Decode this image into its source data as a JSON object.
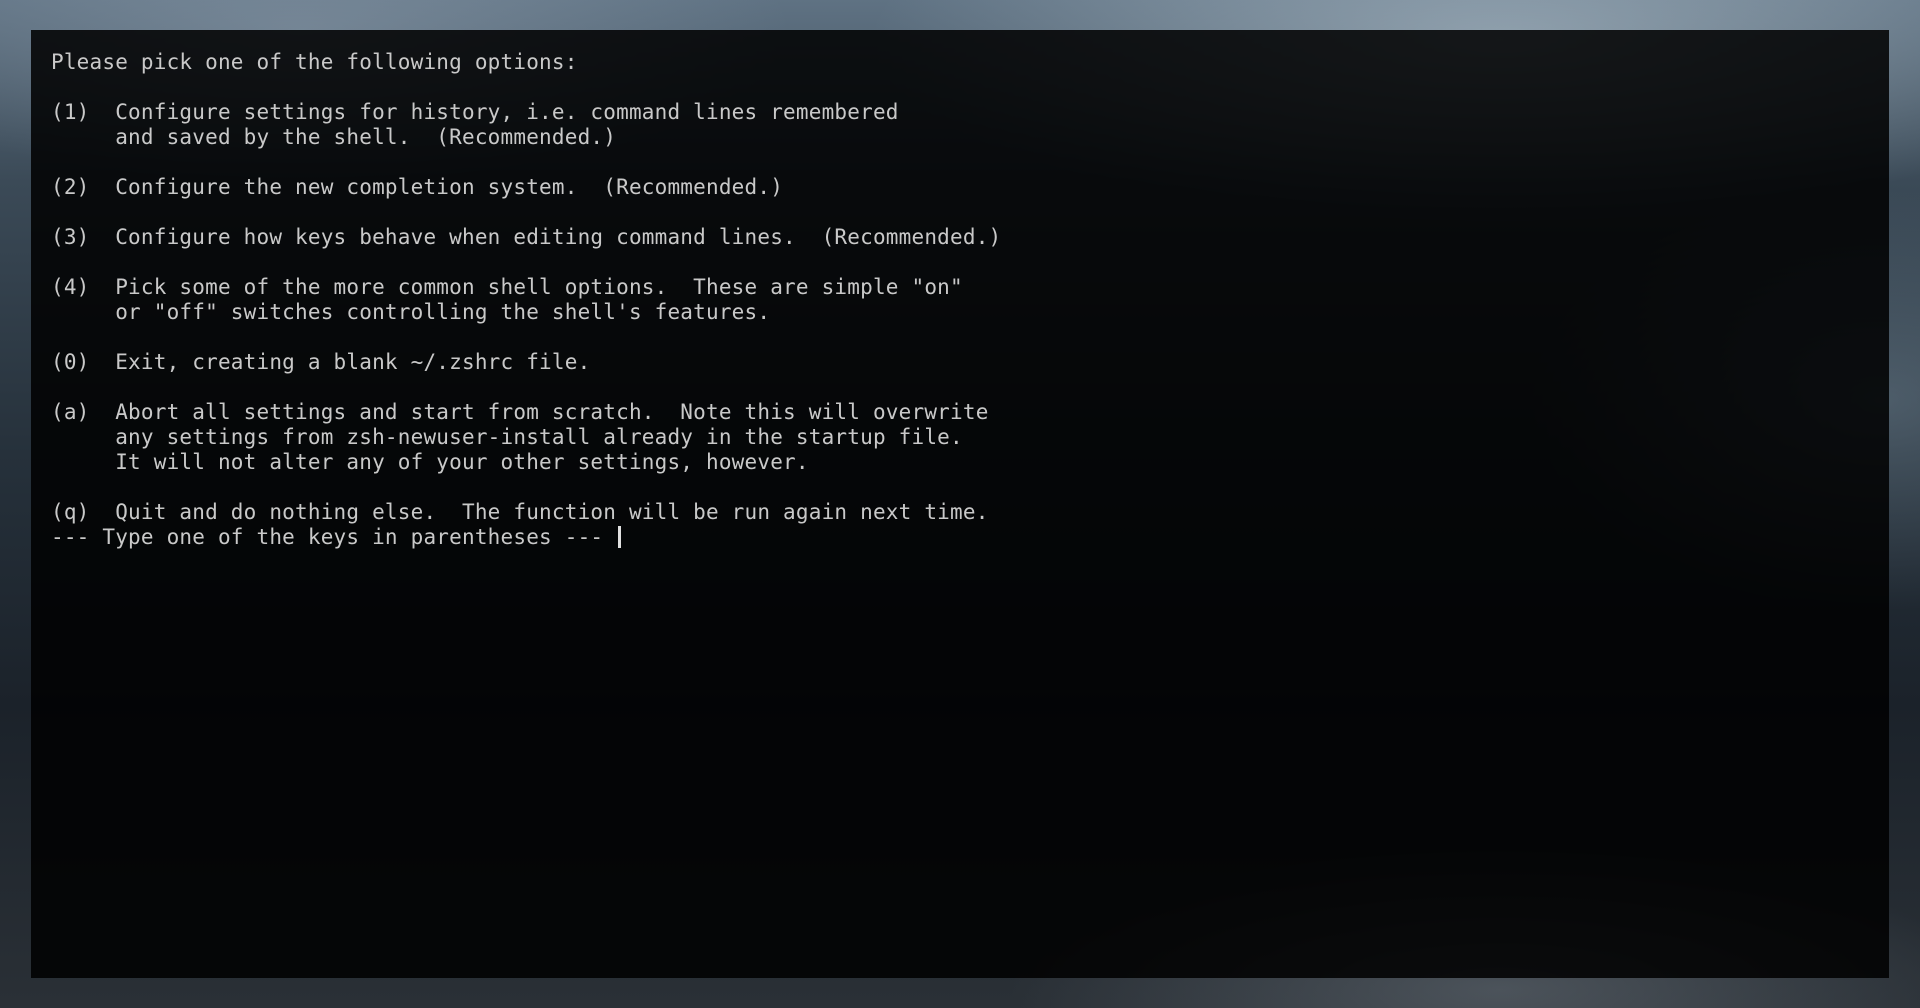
{
  "terminal": {
    "lines": [
      "Please pick one of the following options:",
      "",
      "(1)  Configure settings for history, i.e. command lines remembered",
      "     and saved by the shell.  (Recommended.)",
      "",
      "(2)  Configure the new completion system.  (Recommended.)",
      "",
      "(3)  Configure how keys behave when editing command lines.  (Recommended.)",
      "",
      "(4)  Pick some of the more common shell options.  These are simple \"on\"",
      "     or \"off\" switches controlling the shell's features.",
      "",
      "(0)  Exit, creating a blank ~/.zshrc file.",
      "",
      "(a)  Abort all settings and start from scratch.  Note this will overwrite",
      "     any settings from zsh-newuser-install already in the startup file.",
      "     It will not alter any of your other settings, however.",
      "",
      "(q)  Quit and do nothing else.  The function will be run again next time."
    ],
    "prompt": "--- Type one of the keys in parentheses --- "
  }
}
